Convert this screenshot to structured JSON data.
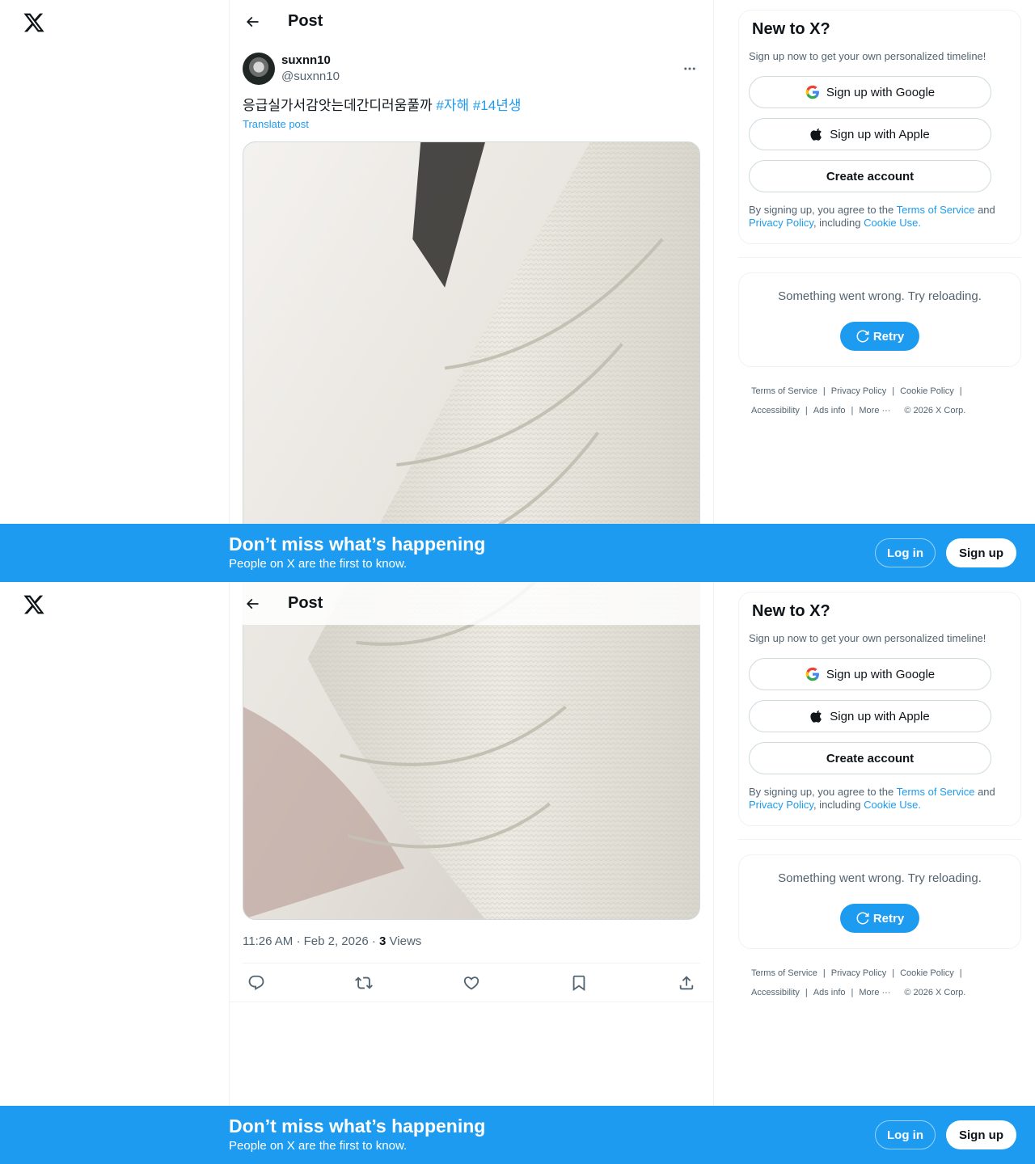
{
  "header": {
    "title": "Post"
  },
  "post": {
    "author_name": "suxnn10",
    "author_handle": "@suxnn10",
    "text": "응급실가서감앗는데간디러움풀까",
    "hashtags": [
      "#자해",
      "#14년생"
    ],
    "translate_label": "Translate post",
    "time": "11:26 AM",
    "date": "Feb 2, 2026",
    "views_count": "3",
    "views_label": "Views"
  },
  "signup_card": {
    "heading": "New to X?",
    "subheading": "Sign up now to get your own personalized timeline!",
    "google_label": "Sign up with Google",
    "apple_label": "Sign up with Apple",
    "create_label": "Create account",
    "legal_prefix": "By signing up, you agree to the",
    "tos_link": "Terms of Service",
    "legal_and": "and",
    "privacy_link": "Privacy Policy",
    "legal_including": ", including",
    "cookie_link": "Cookie Use."
  },
  "error_card": {
    "message": "Something went wrong. Try reloading.",
    "retry_label": "Retry"
  },
  "footer": {
    "terms": "Terms of Service",
    "privacy": "Privacy Policy",
    "cookie": "Cookie Policy",
    "accessibility": "Accessibility",
    "ads_info": "Ads info",
    "more": "More ···",
    "copyright": "© 2026 X Corp."
  },
  "banner": {
    "headline": "Don’t miss what’s happening",
    "subline": "People on X are the first to know.",
    "login_label": "Log in",
    "signup_label": "Sign up"
  },
  "colors": {
    "accent": "#1d9bf0",
    "text_primary": "#0f1419",
    "text_secondary": "#536471",
    "border": "#eff3f4"
  }
}
